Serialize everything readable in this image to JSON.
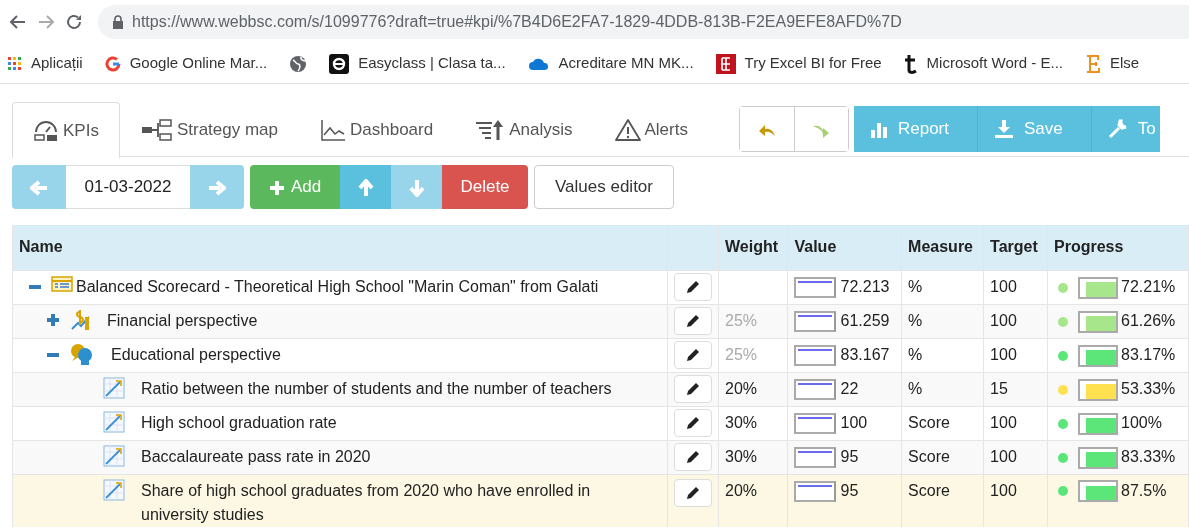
{
  "browser": {
    "url": "https://www.webbsc.com/s/1099776?draft=true#kpi/%7B4D6E2FA7-1829-4DDB-813B-F2EA9EFE8AFD%7D",
    "bookmarks": [
      {
        "label": "Aplicații",
        "kind": "apps"
      },
      {
        "label": "Google Online Mar...",
        "kind": "google"
      },
      {
        "kind": "globe"
      },
      {
        "label": "Easyclass | Clasa ta...",
        "kind": "easyclass"
      },
      {
        "label": "Acreditare MN MK...",
        "kind": "cloud"
      },
      {
        "label": "Try Excel BI for Free",
        "kind": "excel"
      },
      {
        "label": "Microsoft Word - E...",
        "kind": "tee"
      },
      {
        "label": "Else",
        "kind": "serif"
      }
    ]
  },
  "tabs": [
    {
      "label": "KPIs",
      "kind": "kpis",
      "selected": true
    },
    {
      "label": "Strategy map",
      "kind": "map",
      "selected": false
    },
    {
      "label": "Dashboard",
      "kind": "dashboard",
      "selected": false
    },
    {
      "label": "Analysis",
      "kind": "analysis",
      "selected": false
    },
    {
      "label": "Alerts",
      "kind": "alerts",
      "selected": false
    }
  ],
  "history_buttons": [
    {
      "kind": "undo"
    },
    {
      "kind": "redo"
    }
  ],
  "action_buttons": [
    {
      "label": "Report",
      "kind": "report"
    },
    {
      "label": "Save",
      "kind": "save"
    },
    {
      "label": "To",
      "kind": "tools"
    }
  ],
  "toolbar": {
    "date": "01-03-2022",
    "buttons": [
      {
        "label": "Add",
        "kind": "add"
      },
      {
        "kind": "up"
      },
      {
        "kind": "down"
      },
      {
        "label": "Delete",
        "kind": "delete"
      },
      {
        "label": "Values editor",
        "kind": "plain"
      }
    ]
  },
  "table": {
    "columns": [
      "Name",
      "Weight",
      "Value",
      "Measure",
      "Target",
      "Progress"
    ],
    "rows": [
      {
        "name": "Balanced Scorecard - Theoretical High School \"Marin Coman\" from Galati",
        "kind": "scorecard",
        "expanded": true,
        "selected": false,
        "value": "72.213",
        "measure": "%",
        "target": "100",
        "progress": {
          "text": "72.21%",
          "color": "#a8e68c"
        },
        "children": [
          {
            "name": "Financial perspective",
            "kind": "finance",
            "expanded": false,
            "selected": false,
            "weight": "25%",
            "weight_derived": true,
            "value": "61.259",
            "measure": "%",
            "target": "100",
            "progress": {
              "text": "61.26%",
              "color": "#a8e68c"
            }
          },
          {
            "name": "Educational perspective",
            "kind": "education",
            "expanded": true,
            "selected": false,
            "weight": "25%",
            "weight_derived": true,
            "value": "83.167",
            "measure": "%",
            "target": "100",
            "progress": {
              "text": "83.17%",
              "color": "#5ce679"
            },
            "children": [
              {
                "name": "Ratio between the number of students and the number of teachers",
                "kind": "kpi",
                "selected": false,
                "weight": "20%",
                "weight_derived": false,
                "value": "22",
                "measure": "%",
                "target": "15",
                "progress": {
                  "text": "53.33%",
                  "color": "#ffe14f"
                }
              },
              {
                "name": "High school graduation rate",
                "kind": "kpi",
                "selected": false,
                "weight": "30%",
                "weight_derived": false,
                "value": "100",
                "measure": "Score",
                "target": "100",
                "progress": {
                  "text": "100%",
                  "color": "#5ce679"
                }
              },
              {
                "name": "Baccalaureate pass rate in 2020",
                "kind": "kpi",
                "selected": false,
                "weight": "30%",
                "weight_derived": false,
                "value": "95",
                "measure": "Score",
                "target": "100",
                "progress": {
                  "text": "83.33%",
                  "color": "#5ce679"
                }
              },
              {
                "name": "Share of high school graduates from 2020 who have enrolled in university studies",
                "kind": "kpi",
                "selected": true,
                "weight": "20%",
                "weight_derived": false,
                "value": "95",
                "measure": "Score",
                "target": "100",
                "progress": {
                  "text": "87.5%",
                  "color": "#5ce679"
                }
              }
            ]
          }
        ]
      }
    ]
  }
}
